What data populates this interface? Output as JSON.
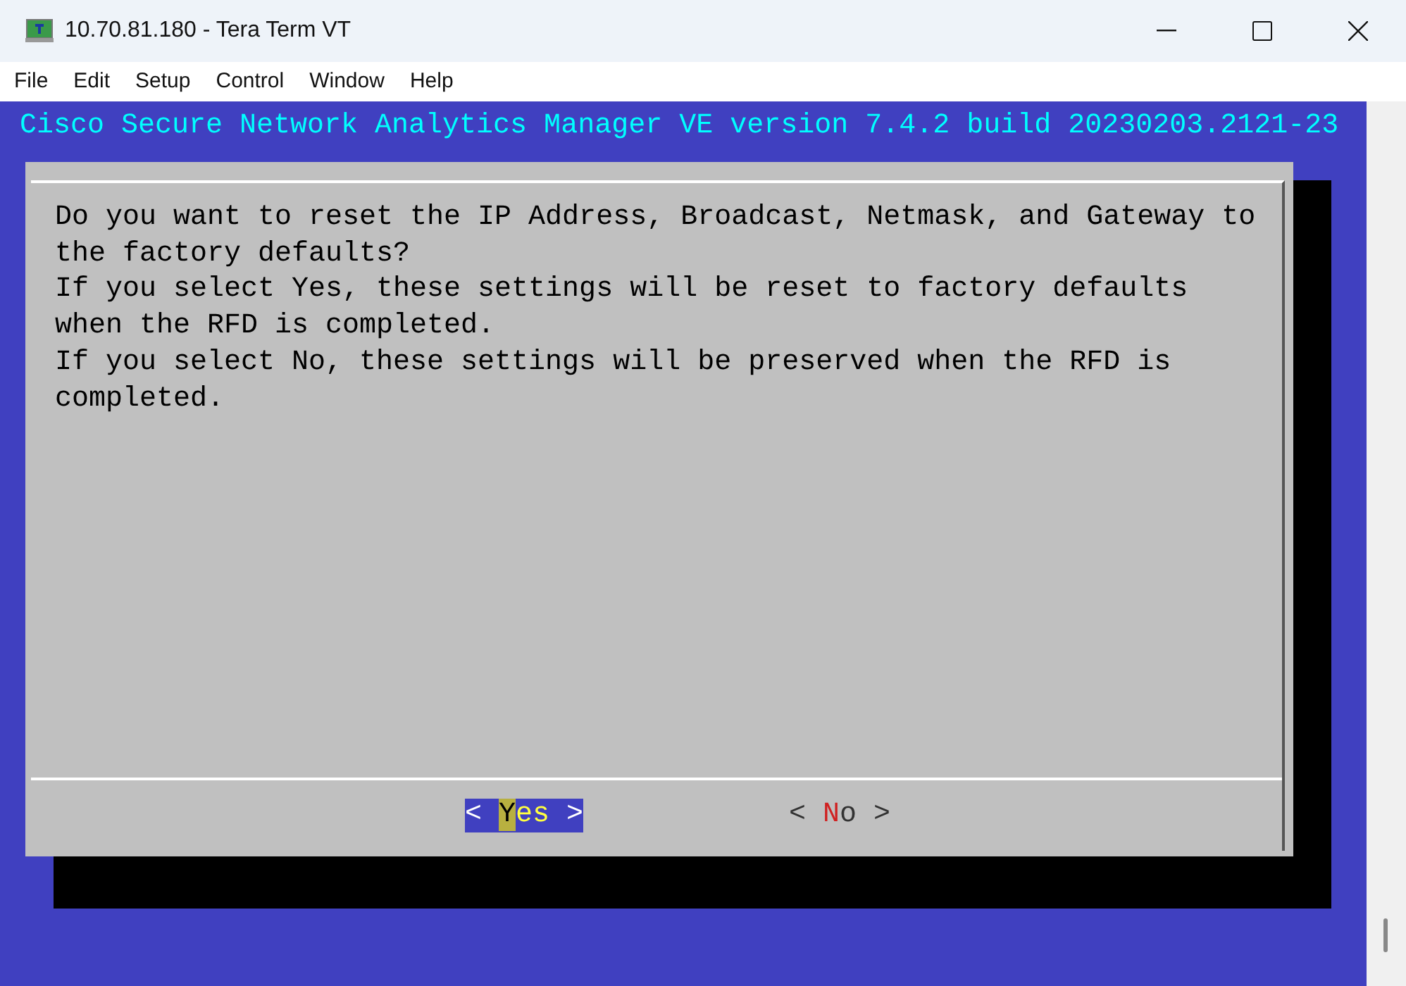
{
  "window": {
    "title": "10.70.81.180 - Tera Term VT"
  },
  "menu": [
    "File",
    "Edit",
    "Setup",
    "Control",
    "Window",
    "Help"
  ],
  "terminal": {
    "header": "Cisco Secure Network Analytics Manager VE version 7.4.2 build 20230203.2121-23",
    "dialog": {
      "lines": [
        "Do you want to reset the IP Address, Broadcast, Netmask, and Gateway to",
        "the factory defaults?",
        "If you select Yes, these settings will be reset to factory defaults",
        "when the RFD is completed.",
        "If you select No, these settings will be preserved when the RFD is",
        "completed."
      ],
      "buttons": [
        {
          "open": "<",
          "hotkey": "Y",
          "rest": "es",
          "close": ">",
          "selected": true
        },
        {
          "open": "<",
          "hotkey": "N",
          "rest": "o",
          "close": ">",
          "selected": false
        }
      ]
    }
  }
}
